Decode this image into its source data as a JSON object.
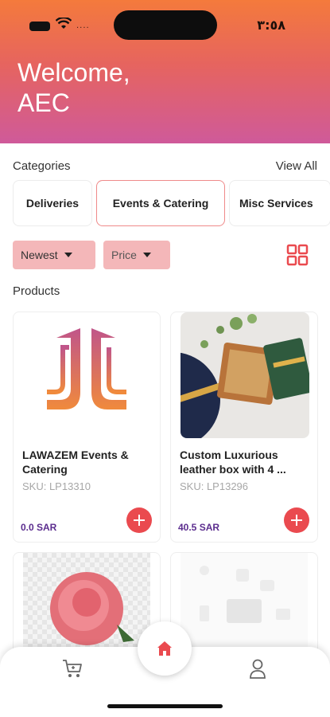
{
  "status_bar": {
    "time": "٣:٥٨",
    "signal_text": "....",
    "icons": [
      "battery-icon",
      "wifi-icon"
    ]
  },
  "header": {
    "greeting_line1": "Welcome,",
    "greeting_line2": "AEC",
    "gradient_colors": [
      "#f47a3c",
      "#e6645f",
      "#cf5a9a"
    ]
  },
  "categories": {
    "title": "Categories",
    "view_all": "View All",
    "items": [
      {
        "label": "Deliveries",
        "active": false
      },
      {
        "label": "Events & Catering",
        "active": true
      },
      {
        "label": "Misc Services",
        "active": false
      }
    ]
  },
  "filters": {
    "sort_label": "Newest",
    "price_label": "Price",
    "view_toggle_icon": "grid-icon"
  },
  "products": {
    "title": "Products",
    "items": [
      {
        "name": "LAWAZEM Events & Catering",
        "sku": "SKU: LP13310",
        "price": "0.0 SAR"
      },
      {
        "name": "Custom Luxurious leather box with 4 ...",
        "sku": "SKU: LP13296",
        "price": "40.5 SAR"
      },
      {
        "name": "",
        "sku": "",
        "price": ""
      },
      {
        "name": "",
        "sku": "",
        "price": ""
      }
    ]
  },
  "nav": {
    "items": [
      "cart-icon",
      "home-icon",
      "user-icon"
    ],
    "accent": "#ea4a4f"
  },
  "colors": {
    "accent": "#ea4a4f",
    "filter_bg": "#f4b7b9",
    "price_text": "#5b2d8e"
  }
}
